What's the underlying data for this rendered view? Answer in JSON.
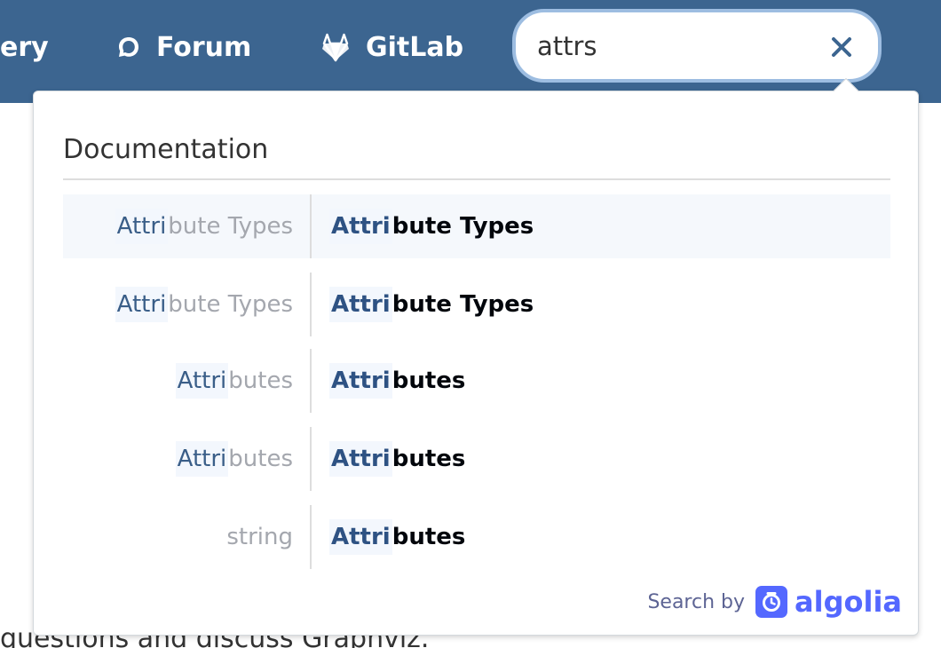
{
  "navbar": {
    "items": [
      {
        "label": "ery",
        "icon": null
      },
      {
        "label": "Forum",
        "icon": "chat-bubble-icon"
      },
      {
        "label": "GitLab",
        "icon": "gitlab-icon"
      }
    ]
  },
  "search": {
    "value": "attrs",
    "clear_icon": "close-icon"
  },
  "page_text": "questions and discuss Graphviz.",
  "dropdown": {
    "section_title": "Documentation",
    "results": [
      {
        "left_match": "Attri",
        "left_rest": "bute Types",
        "right_match": "Attri",
        "right_rest": "bute Types",
        "selected": true
      },
      {
        "left_match": "Attri",
        "left_rest": "bute Types",
        "right_match": "Attri",
        "right_rest": "bute Types",
        "selected": false
      },
      {
        "left_match": "Attri",
        "left_rest": "butes",
        "right_match": "Attri",
        "right_rest": "butes",
        "selected": false
      },
      {
        "left_match": "Attri",
        "left_rest": "butes",
        "right_match": "Attri",
        "right_rest": "butes",
        "selected": false
      },
      {
        "left_match": "",
        "left_rest": "string",
        "right_match": "Attri",
        "right_rest": "butes",
        "selected": false
      }
    ],
    "footer": {
      "label": "Search by",
      "brand": "algolia"
    }
  },
  "colors": {
    "navbar_bg": "#3c6590",
    "search_border": "#9dbde1",
    "highlight_bg": "#f3f7fd",
    "highlight_text": "#2e5283",
    "algolia_brand": "#5468ff"
  }
}
